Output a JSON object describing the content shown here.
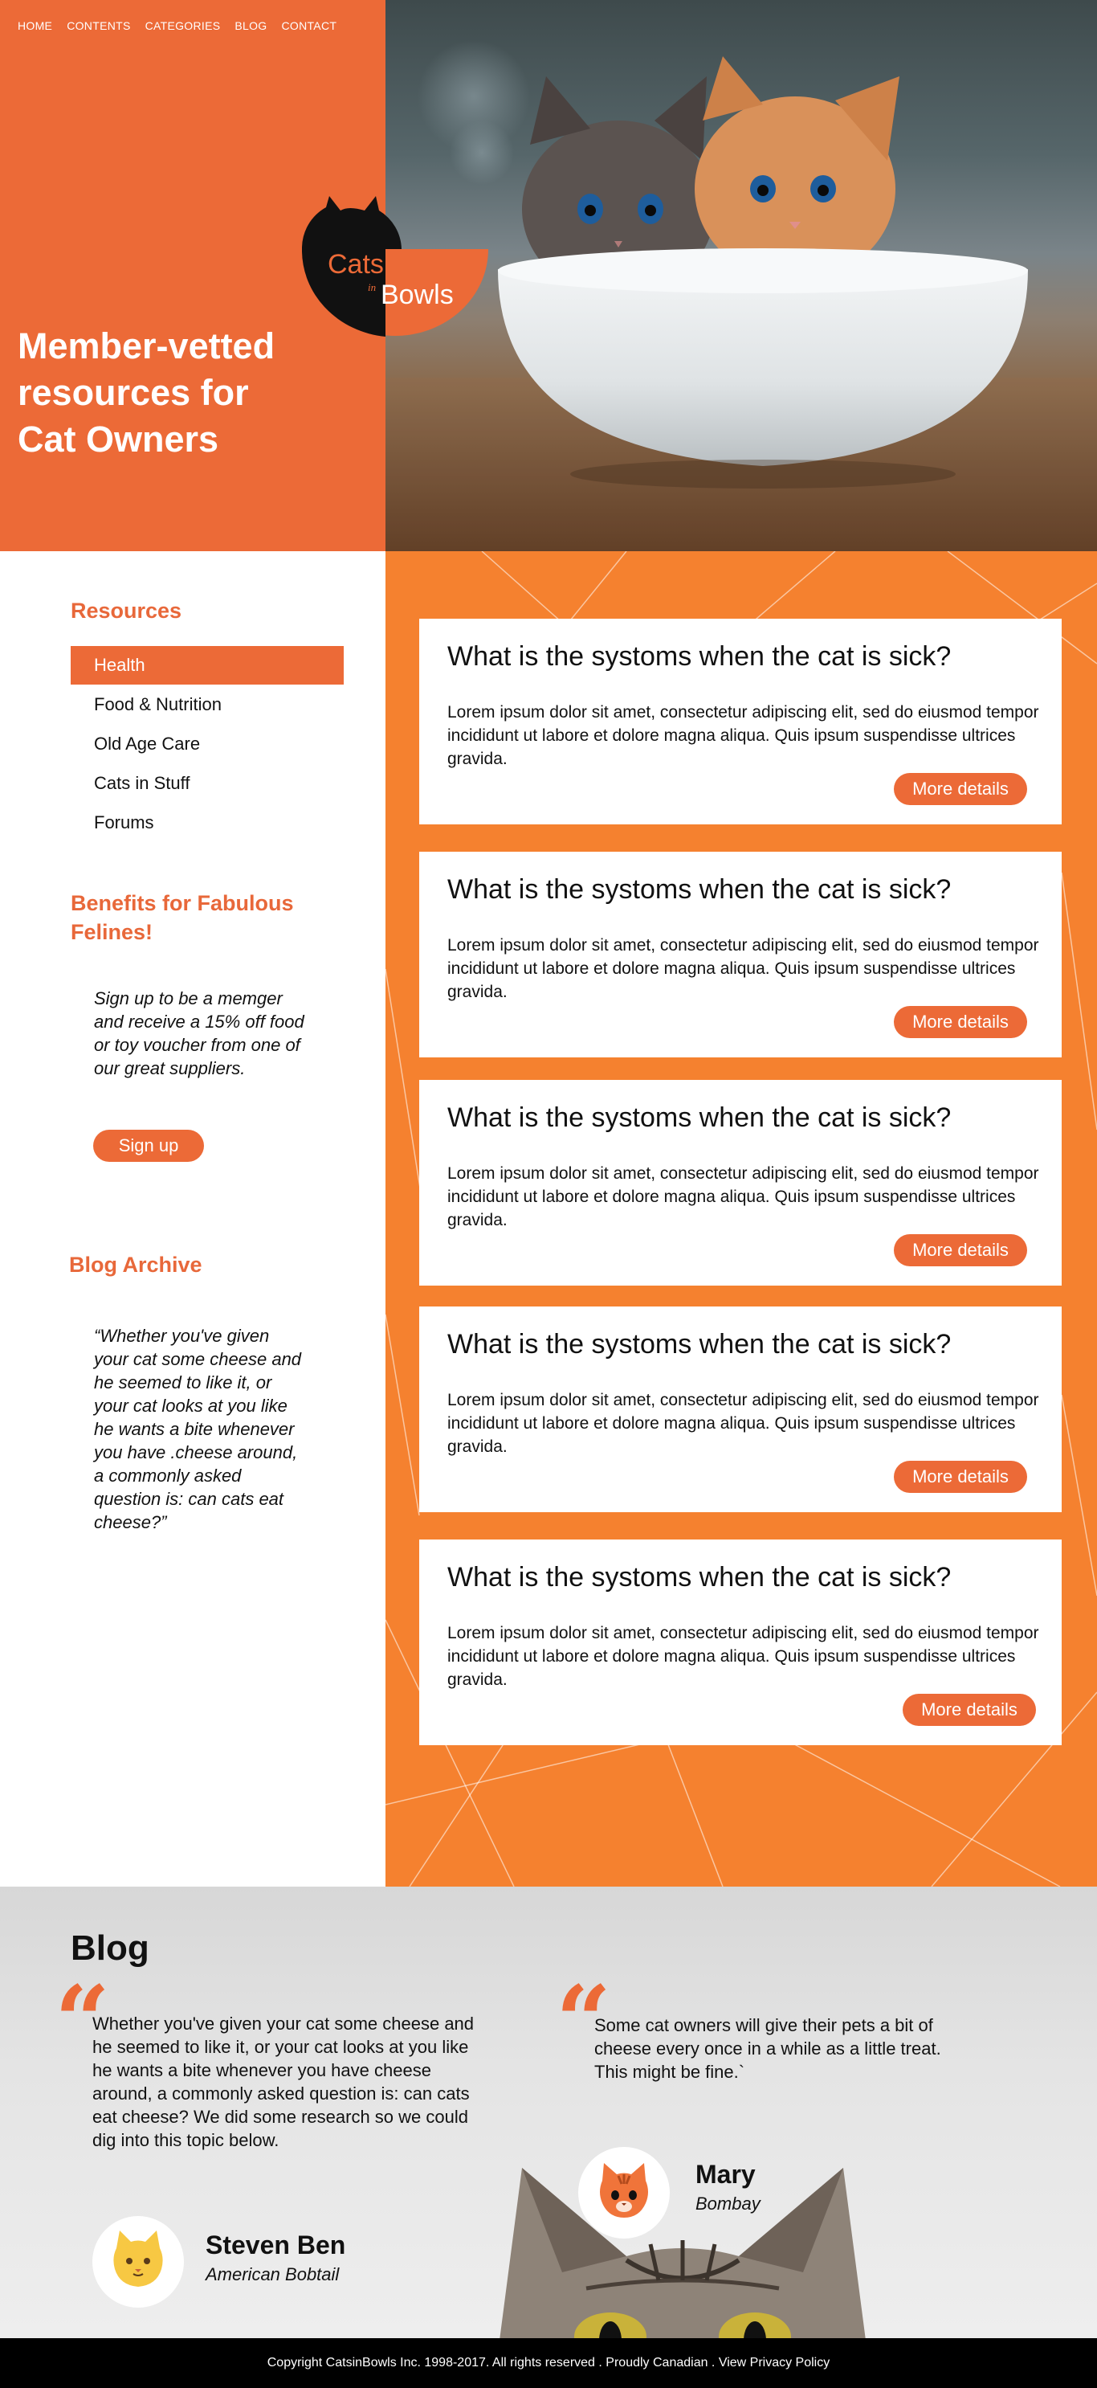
{
  "nav": {
    "items": [
      "HOME",
      "CONTENTS",
      "CATEGORIES",
      "BLOG",
      "CONTACT"
    ]
  },
  "hero": {
    "title": "Member-vetted resources for Cat Owners"
  },
  "logo": {
    "word1": "Cats",
    "word2": "in",
    "word3": "Bowls"
  },
  "resources": {
    "heading": "Resources",
    "items": [
      "Health",
      "Food & Nutrition",
      "Old Age Care",
      "Cats in Stuff",
      "Forums"
    ],
    "active_index": 0
  },
  "benefits": {
    "heading": "Benefits for Fabulous Felines!",
    "text": "Sign up to be a memger and receive a 15% off food or toy voucher from one of our great suppliers.",
    "button": "Sign up"
  },
  "blog_archive": {
    "heading": "Blog Archive",
    "quote": "“Whether you've given your cat some cheese and he seemed to like it, or your cat looks at you like he wants a bite whenever you have .cheese around, a commonly asked question is: can cats eat cheese?”"
  },
  "articles": [
    {
      "title": "What is the systoms when the cat is sick?",
      "body": "Lorem ipsum dolor sit amet, consectetur adipiscing elit, sed do eiusmod tempor incididunt ut labore et dolore magna aliqua. Quis ipsum suspendisse ultrices gravida.",
      "button": "More details"
    },
    {
      "title": "What is the systoms when the cat is sick?",
      "body": "Lorem ipsum dolor sit amet, consectetur adipiscing elit, sed do eiusmod tempor incididunt ut labore et dolore magna aliqua. Quis ipsum suspendisse ultrices gravida.",
      "button": "More details"
    },
    {
      "title": "What is the systoms when the cat is sick?",
      "body": "Lorem ipsum dolor sit amet, consectetur adipiscing elit, sed do eiusmod tempor incididunt ut labore et dolore magna aliqua. Quis ipsum suspendisse ultrices gravida.",
      "button": "More details"
    },
    {
      "title": "What is the systoms when the cat is sick?",
      "body": "Lorem ipsum dolor sit amet, consectetur adipiscing elit, sed do eiusmod tempor incididunt ut labore et dolore magna aliqua. Quis ipsum suspendisse ultrices gravida.",
      "button": "More details"
    },
    {
      "title": "What is the systoms when the cat is sick?",
      "body": "Lorem ipsum dolor sit amet, consectetur adipiscing elit, sed do eiusmod tempor incididunt ut labore et dolore magna aliqua. Quis ipsum suspendisse ultrices gravida.",
      "button": "More details"
    }
  ],
  "blog": {
    "title": "Blog",
    "testimonials": [
      {
        "text": "Whether you've given your cat some cheese and he seemed to like it, or your cat looks at you like he wants a bite whenever you have cheese around, a commonly asked question is: can cats eat cheese? We did some research so we could dig into this topic below.",
        "name": "Steven Ben",
        "breed": "American Bobtail"
      },
      {
        "text": "Some cat owners will give their pets a bit of cheese every once in a while as a little treat. This might be fine.`",
        "name": "Mary",
        "breed": "Bombay"
      }
    ]
  },
  "footer": {
    "text": "Copyright CatsinBowls Inc. 1998-2017. All rights reserved . Proudly Canadian . View Privacy Policy"
  },
  "colors": {
    "accent": "#ec6a37",
    "panel": "#f5812f",
    "footer": "#000000"
  }
}
